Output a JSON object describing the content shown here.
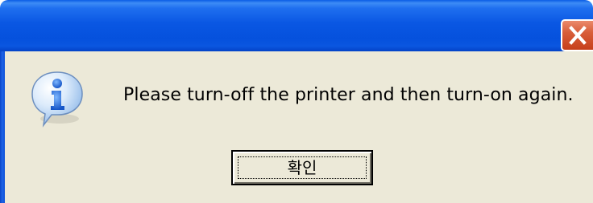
{
  "dialog": {
    "message": "Please turn-off the printer and then turn-on again.",
    "icon": "information-icon",
    "ok_label": "확인",
    "close_icon": "close-icon"
  },
  "colors": {
    "titlebar": "#0a57e3",
    "close_button": "#d85e3a",
    "dialog_background": "#ece9d8",
    "info_icon": "#2f7fe6"
  }
}
